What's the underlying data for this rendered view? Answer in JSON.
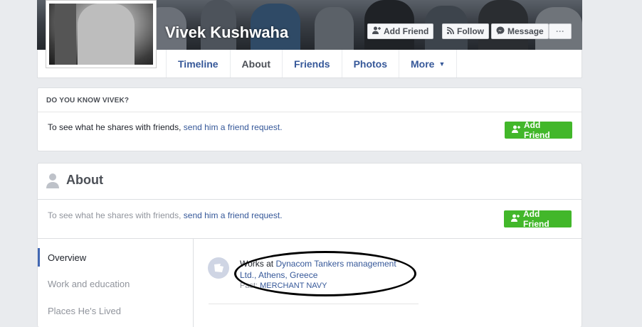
{
  "profile": {
    "name": "Vivek Kushwaha"
  },
  "header_buttons": {
    "add_friend": "Add Friend",
    "follow": "Follow",
    "message": "Message",
    "more": "···"
  },
  "tabs": [
    {
      "label": "Timeline",
      "active": false
    },
    {
      "label": "About",
      "active": true
    },
    {
      "label": "Friends",
      "active": false
    },
    {
      "label": "Photos",
      "active": false
    },
    {
      "label": "More",
      "active": false
    }
  ],
  "do_you_know": {
    "title": "DO YOU KNOW VIVEK?",
    "text_prefix": "To see what he shares with friends,",
    "link": "send him a friend request.",
    "button": "Add Friend"
  },
  "about": {
    "title": "About",
    "note_prefix": "To see what he shares with friends,",
    "note_link": "send him a friend request.",
    "button": "Add Friend",
    "sidebar": [
      {
        "label": "Overview",
        "active": true
      },
      {
        "label": "Work and education",
        "active": false
      },
      {
        "label": "Places He's Lived",
        "active": false
      }
    ],
    "work": {
      "prefix": "Works at",
      "company": "Dynacom Tankers management Ltd., Athens, Greece",
      "past_label": "Past:",
      "past_value": "MERCHANT NAVY"
    }
  },
  "colors": {
    "link": "#365899",
    "green": "#42b72a",
    "accent": "#4267b2",
    "background": "#e9ebee"
  }
}
